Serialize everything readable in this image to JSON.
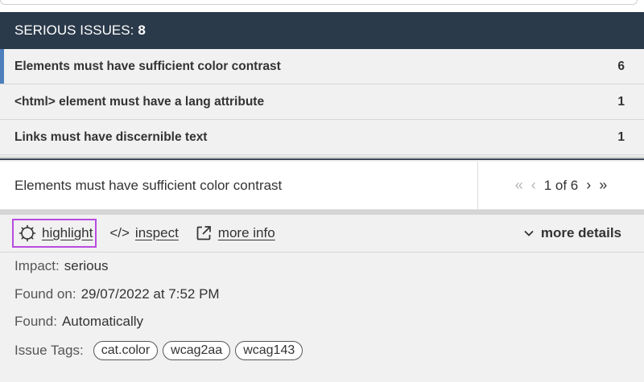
{
  "header": {
    "title": "SERIOUS ISSUES:",
    "count": "8"
  },
  "issues": [
    {
      "label": "Elements must have sufficient color contrast",
      "count": "6"
    },
    {
      "label": "<html> element must have a lang attribute",
      "count": "1"
    },
    {
      "label": "Links must have discernible text",
      "count": "1"
    }
  ],
  "detail": {
    "title": "Elements must have sufficient color contrast",
    "pager": {
      "first": "«",
      "prev": "‹",
      "status": "1 of 6",
      "next": "›",
      "last": "»"
    }
  },
  "toolbar": {
    "highlight_label": "highlight",
    "inspect_label": "inspect",
    "inspect_icon": "</>",
    "more_info_label": "more info",
    "more_details_label": "more details"
  },
  "info": {
    "impact_label": "Impact:",
    "impact_value": "serious",
    "found_on_label": "Found on:",
    "found_on_value": "29/07/2022 at 7:52 PM",
    "found_label": "Found:",
    "found_value": "Automatically",
    "tags_label": "Issue Tags:",
    "tags": [
      "cat.color",
      "wcag2aa",
      "wcag143"
    ]
  },
  "colors": {
    "header_bg": "#2b3a4a",
    "active_accent": "#4e7fbd",
    "highlight_border": "#b84cdf"
  }
}
